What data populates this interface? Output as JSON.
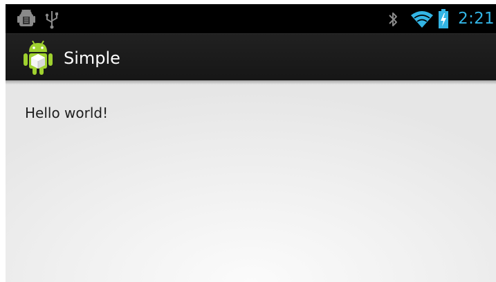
{
  "status_bar": {
    "time": "2:21",
    "left_icons": [
      "android-debug-icon",
      "usb-icon"
    ],
    "right_icons": [
      "bluetooth-icon",
      "wifi-icon",
      "battery-charging-icon"
    ],
    "accent_color": "#33b5e5"
  },
  "action_bar": {
    "app_icon": "android-app-icon",
    "title": "Simple"
  },
  "main": {
    "text": "Hello world!"
  }
}
